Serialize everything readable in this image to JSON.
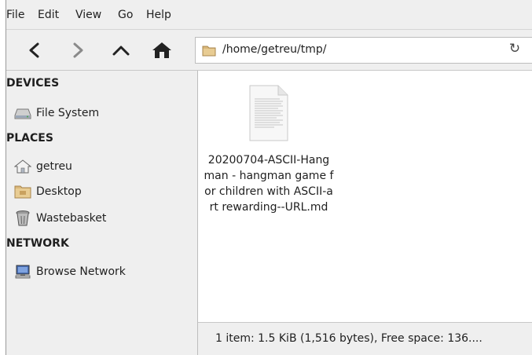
{
  "menu": {
    "items": [
      "File",
      "Edit",
      "View",
      "Go",
      "Help"
    ]
  },
  "toolbar": {
    "icons": [
      "back-icon",
      "forward-icon",
      "up-icon",
      "home-icon"
    ],
    "location": "/home/getreu/tmp/",
    "reload_icon": "reload-icon"
  },
  "sidebar": {
    "sections": [
      {
        "heading": "DEVICES",
        "items": [
          {
            "label": "File System",
            "icon": "drive-icon"
          }
        ]
      },
      {
        "heading": "PLACES",
        "items": [
          {
            "label": "getreu",
            "icon": "home-folder-icon"
          },
          {
            "label": "Desktop",
            "icon": "desktop-folder-icon"
          },
          {
            "label": "Wastebasket",
            "icon": "trash-icon"
          }
        ]
      },
      {
        "heading": "NETWORK",
        "items": [
          {
            "label": "Browse Network",
            "icon": "network-icon"
          }
        ]
      }
    ]
  },
  "files": [
    {
      "name": "20200704-ASCII-Hangman - hangman game for children with ASCII-art rewarding--URL.md",
      "icon": "text-document-icon"
    }
  ],
  "status": {
    "text": "1 item: 1.5 KiB (1,516 bytes), Free space: 136...."
  }
}
